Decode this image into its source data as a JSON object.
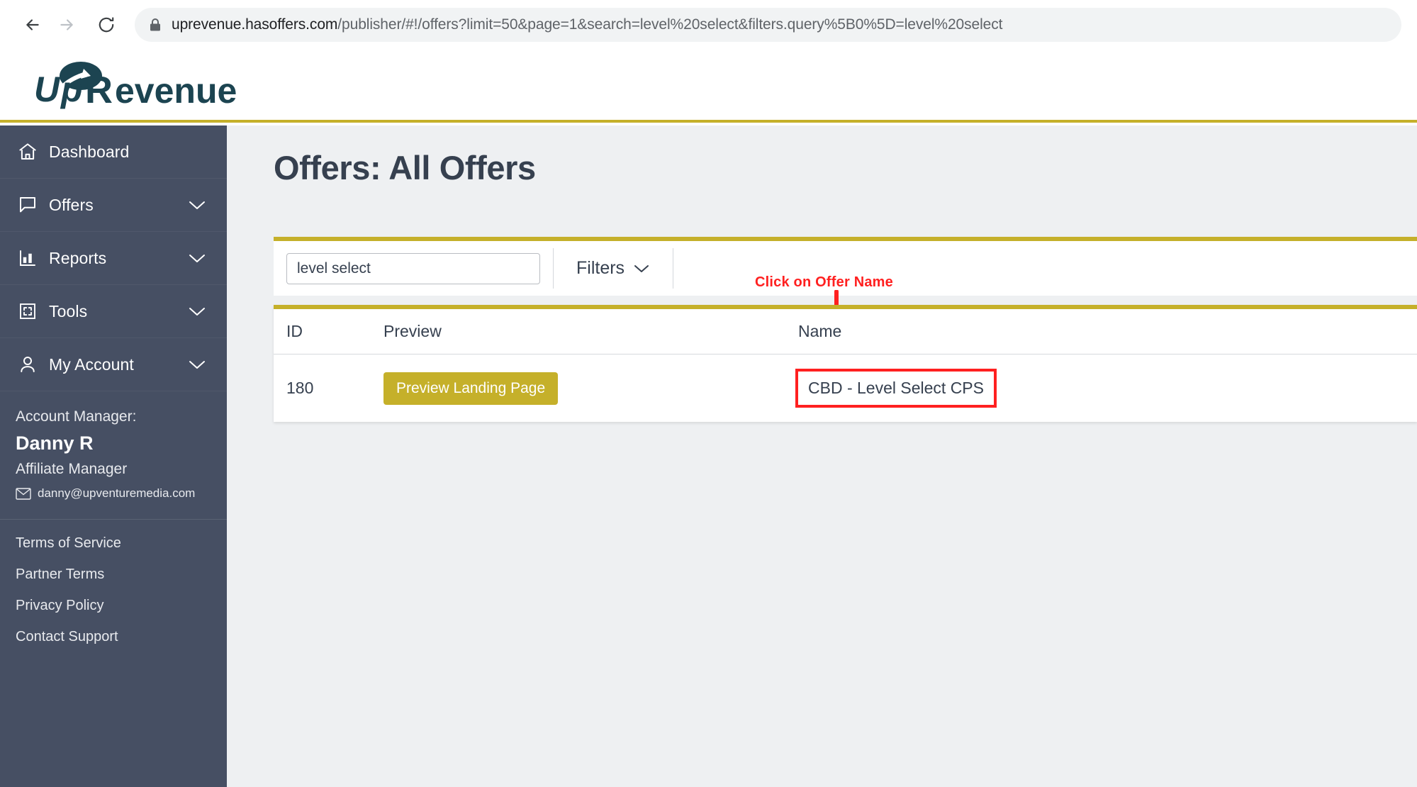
{
  "browser": {
    "back_icon": "back-arrow-icon",
    "forward_icon": "forward-arrow-icon",
    "reload_icon": "reload-icon",
    "lock_icon": "lock-icon",
    "url_domain": "uprevenue.hasoffers.com",
    "url_path": "/publisher/#!/offers?limit=50&page=1&search=level%20select&filters.query%5B0%5D=level%20select"
  },
  "header": {
    "logo_text": "UpRevenue",
    "accent_color": "#c5b02a",
    "logo_color": "#1c4451"
  },
  "sidebar": {
    "background": "#464f63",
    "items": [
      {
        "label": "Dashboard",
        "icon": "home-icon",
        "has_chevron": false
      },
      {
        "label": "Offers",
        "icon": "speech-bubble-icon",
        "has_chevron": true
      },
      {
        "label": "Reports",
        "icon": "bar-chart-icon",
        "has_chevron": true
      },
      {
        "label": "Tools",
        "icon": "tools-grid-icon",
        "has_chevron": true
      },
      {
        "label": "My Account",
        "icon": "user-icon",
        "has_chevron": true
      }
    ],
    "account_manager": {
      "label": "Account Manager:",
      "name": "Danny R",
      "role": "Affiliate Manager",
      "email": "danny@upventuremedia.com",
      "mail_icon": "envelope-icon"
    },
    "footer_links": [
      "Terms of Service",
      "Partner Terms",
      "Privacy Policy",
      "Contact Support"
    ]
  },
  "main": {
    "page_title": "Offers: All Offers",
    "toolbar": {
      "search_value": "level select",
      "search_placeholder": "Search",
      "filters_label": "Filters",
      "filters_chevron_icon": "chevron-down-icon"
    },
    "annotation": {
      "text": "Click on Offer Name",
      "color": "#ff2020",
      "arrow_icon": "down-arrow-annotation-icon"
    },
    "table": {
      "columns": [
        "ID",
        "Preview",
        "Name"
      ],
      "rows": [
        {
          "id": "180",
          "preview_button_label": "Preview Landing Page",
          "name": "CBD - Level Select CPS",
          "name_highlighted": true
        }
      ]
    }
  }
}
